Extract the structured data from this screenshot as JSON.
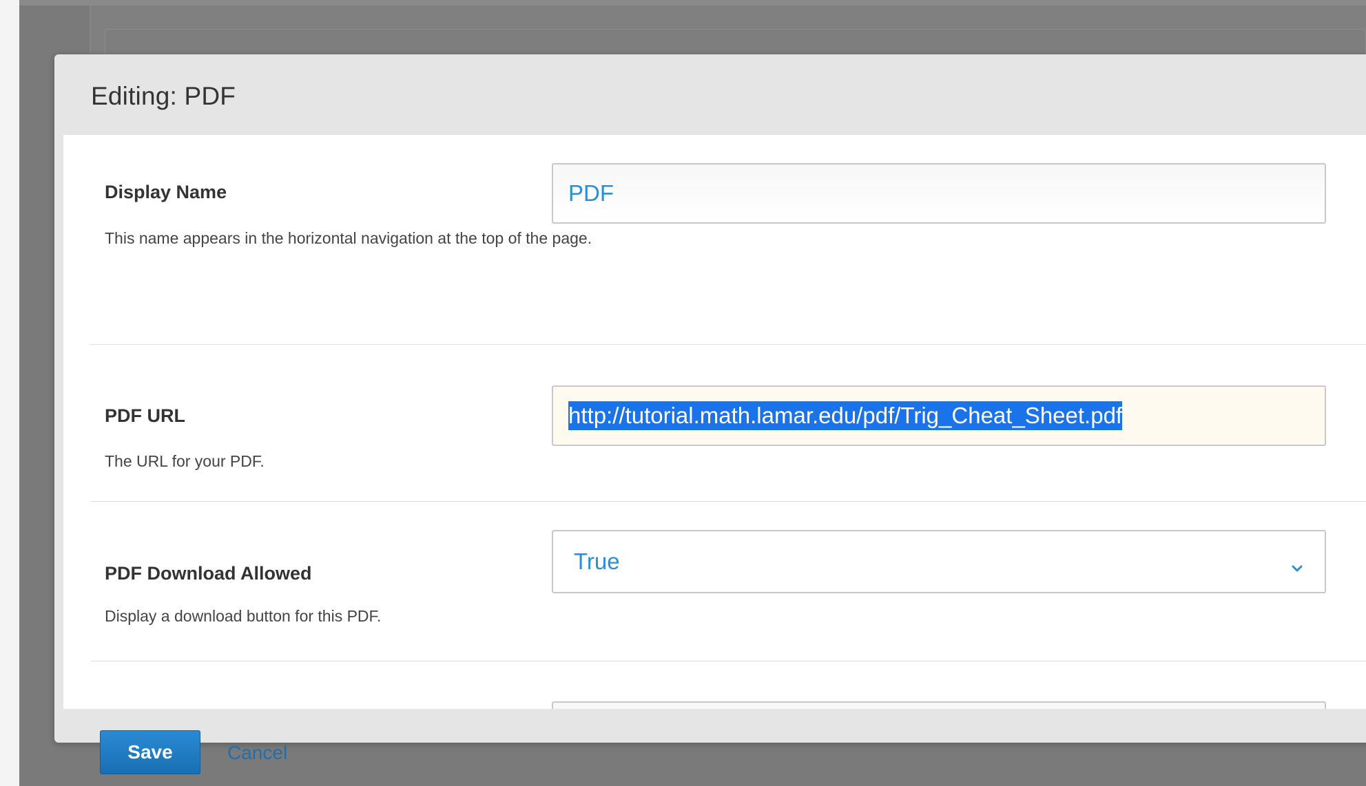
{
  "modal": {
    "title": "Editing: PDF"
  },
  "fields": {
    "display_name": {
      "label": "Display Name",
      "value": "PDF",
      "help": "This name appears in the horizontal navigation at the top of the page."
    },
    "pdf_url": {
      "label": "PDF URL",
      "value": "http://tutorial.math.lamar.edu/pdf/Trig_Cheat_Sheet.pdf",
      "help": "The URL for your PDF."
    },
    "pdf_download_allowed": {
      "label": "PDF Download Allowed",
      "selected": "True",
      "help": "Display a download button for this PDF."
    }
  },
  "footer": {
    "save_label": "Save",
    "cancel_label": "Cancel"
  },
  "colors": {
    "accent": "#2b8fd1",
    "primary_button": "#1a6fb3",
    "selection": "#1a73e8"
  },
  "icons": {
    "select_arrow": "chevron-down-icon"
  }
}
